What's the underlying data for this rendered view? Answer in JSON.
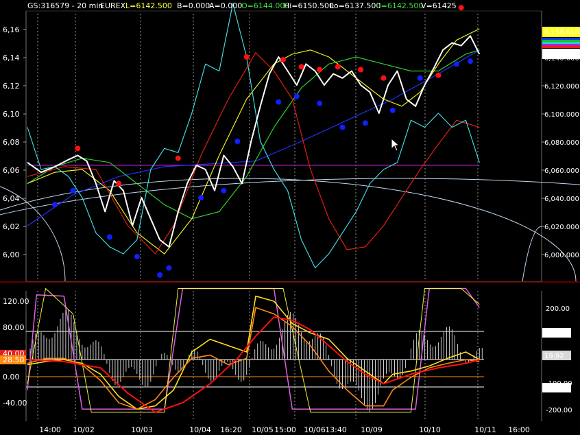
{
  "header": {
    "symbol": "GS:316579 - 20 min",
    "exchange": "EUREX",
    "last": "L=6142.500",
    "bid": "B=0.000",
    "ask": "A=0.000",
    "open": "O=6144.000",
    "high": "Hi=6150.500",
    "low": "Lo=6137.500",
    "close": "C=6142.500",
    "volume": "V=61425"
  },
  "colors": {
    "price": "#ffffff",
    "cyan": "#40d8e0",
    "red_ma": "#e02010",
    "yellow_ma": "#f0f020",
    "green_ma": "#30d030",
    "blue_ma": "#2030ff",
    "magenta_line": "#d020e0",
    "arc": "#c0d8f0",
    "dot_red": "#ff1010",
    "dot_blue": "#1020ff",
    "osc_yellow": "#ffe020",
    "osc_orange": "#ff8c10",
    "osc_red": "#ff1010",
    "osc_magenta": "#e060e0",
    "hist": "#cfcfcf"
  },
  "price_axis": {
    "left_ticks": [
      "6,16",
      "6,14",
      "6,12",
      "6,10",
      "6,08",
      "6,06",
      "6,04",
      "6,02",
      "6,00"
    ],
    "right_ticks": [
      "6,140.000",
      "6,120.000",
      "6,100.000",
      "6,080.000",
      "6,060.000",
      "6,040.000",
      "6,020.000",
      "6,000.000"
    ],
    "badge_top": "6,158.618",
    "badge_last": "6,142.500"
  },
  "osc_axis": {
    "left_ticks": [
      "120.00",
      "80.00",
      "40.00",
      "0.00",
      "-40.00"
    ],
    "right_ticks": [
      "200.00",
      "-200.00"
    ],
    "left_badges": [
      "40.00",
      "28.50"
    ],
    "right_badges": [
      "110.00",
      "19.92",
      "-100.00",
      "-110.00"
    ]
  },
  "time_axis": [
    "14:00",
    "10/02",
    "10/03",
    "10/04",
    "16:20",
    "10/05",
    "15:00",
    "10/06",
    "13:40",
    "10/09",
    "10/10",
    "10/11",
    "16:00"
  ],
  "chart_data": [
    {
      "type": "line",
      "panel": "price",
      "ylim": [
        5990,
        6175
      ],
      "x_index_range": [
        0,
        100
      ],
      "series": [
        {
          "name": "",
          "key": "price",
          "x": [
            0,
            3,
            6,
            9,
            11,
            13,
            15,
            17,
            19,
            21,
            23,
            25,
            27,
            29,
            31,
            33,
            35,
            37,
            39,
            41,
            43,
            45,
            47,
            49,
            51,
            53,
            55,
            57,
            59,
            61,
            63,
            65,
            67,
            69,
            71,
            73,
            75,
            77,
            79,
            81,
            83,
            85,
            87,
            89,
            91,
            93,
            95,
            97,
            99
          ],
          "values": [
            6065,
            6058,
            6062,
            6067,
            6070,
            6066,
            6050,
            6030,
            6052,
            6045,
            6020,
            6040,
            6025,
            6010,
            6005,
            6030,
            6050,
            6063,
            6060,
            6045,
            6070,
            6062,
            6050,
            6080,
            6105,
            6128,
            6140,
            6130,
            6120,
            6135,
            6130,
            6120,
            6128,
            6125,
            6130,
            6120,
            6115,
            6100,
            6120,
            6130,
            6110,
            6105,
            6120,
            6132,
            6145,
            6150,
            6148,
            6155,
            6142
          ]
        },
        {
          "name": "",
          "key": "cyan",
          "x": [
            0,
            3,
            6,
            9,
            12,
            15,
            18,
            21,
            24,
            27,
            30,
            33,
            36,
            39,
            42,
            45,
            48,
            51,
            54,
            57,
            60,
            63,
            66,
            69,
            72,
            75,
            78,
            81,
            84,
            87,
            90,
            93,
            96,
            99
          ],
          "values": [
            6090,
            6060,
            6062,
            6055,
            6040,
            6015,
            6005,
            6000,
            6010,
            6060,
            6075,
            6072,
            6100,
            6135,
            6130,
            6178,
            6140,
            6080,
            6060,
            6045,
            6010,
            5990,
            6000,
            6015,
            6030,
            6050,
            6060,
            6065,
            6095,
            6090,
            6100,
            6090,
            6095,
            6065
          ]
        },
        {
          "name": "",
          "key": "red_ma",
          "x": [
            0,
            8,
            15,
            22,
            28,
            32,
            38,
            44,
            50,
            54,
            58,
            62,
            66,
            70,
            74,
            78,
            82,
            86,
            90,
            94,
            99
          ],
          "values": [
            6055,
            6062,
            6060,
            6020,
            6000,
            6020,
            6070,
            6110,
            6143,
            6130,
            6110,
            6060,
            6025,
            6003,
            6005,
            6020,
            6040,
            6060,
            6078,
            6095,
            6090
          ]
        },
        {
          "name": "",
          "key": "yellow_ma",
          "x": [
            0,
            6,
            12,
            18,
            24,
            30,
            36,
            42,
            48,
            54,
            58,
            62,
            66,
            70,
            74,
            78,
            82,
            86,
            90,
            94,
            99
          ],
          "values": [
            6050,
            6058,
            6060,
            6045,
            6015,
            6000,
            6025,
            6070,
            6110,
            6135,
            6142,
            6145,
            6140,
            6130,
            6120,
            6110,
            6105,
            6115,
            6135,
            6152,
            6160
          ]
        },
        {
          "name": "",
          "key": "green_ma",
          "x": [
            0,
            6,
            12,
            18,
            24,
            30,
            36,
            42,
            48,
            54,
            60,
            66,
            72,
            78,
            84,
            90,
            96,
            99
          ],
          "values": [
            6050,
            6062,
            6068,
            6065,
            6050,
            6035,
            6025,
            6030,
            6055,
            6090,
            6118,
            6135,
            6140,
            6135,
            6130,
            6130,
            6142,
            6145
          ]
        },
        {
          "name": "",
          "key": "blue_ma",
          "x": [
            0,
            10,
            20,
            30,
            40,
            50,
            60,
            70,
            80,
            90,
            99
          ],
          "values": [
            6020,
            6042,
            6055,
            6062,
            6064,
            6066,
            6080,
            6095,
            6110,
            6128,
            6145
          ]
        },
        {
          "name": "",
          "key": "magenta_line",
          "x": [
            0,
            99
          ],
          "values": [
            6063,
            6063
          ]
        }
      ]
    },
    {
      "type": "line",
      "panel": "oscillator",
      "ylim": [
        -60,
        140
      ],
      "series": [
        {
          "name": "",
          "key": "osc_yellow",
          "x": [
            0,
            4,
            8,
            12,
            16,
            20,
            24,
            28,
            32,
            36,
            40,
            44,
            48,
            50,
            54,
            58,
            62,
            66,
            70,
            74,
            78,
            80,
            84,
            88,
            92,
            96,
            99
          ],
          "values": [
            20,
            25,
            28,
            22,
            5,
            -30,
            -50,
            -45,
            -20,
            40,
            60,
            50,
            40,
            128,
            120,
            85,
            70,
            60,
            30,
            10,
            -10,
            5,
            10,
            18,
            30,
            40,
            28
          ]
        },
        {
          "name": "",
          "key": "osc_orange",
          "x": [
            0,
            4,
            8,
            12,
            16,
            20,
            24,
            28,
            32,
            36,
            40,
            44,
            48,
            50,
            54,
            58,
            62,
            66,
            70,
            74,
            78,
            80,
            84,
            88,
            92,
            96,
            99
          ],
          "values": [
            22,
            30,
            30,
            20,
            -5,
            -40,
            -50,
            -35,
            0,
            30,
            35,
            20,
            30,
            110,
            100,
            80,
            50,
            10,
            -20,
            -45,
            -45,
            -20,
            0,
            15,
            22,
            28,
            25
          ]
        },
        {
          "name": "",
          "key": "osc_red",
          "x": [
            0,
            8,
            16,
            22,
            28,
            34,
            40,
            46,
            50,
            54,
            58,
            62,
            66,
            70,
            74,
            78,
            84,
            90,
            96,
            99
          ],
          "values": [
            28,
            25,
            15,
            -25,
            -55,
            -40,
            -10,
            30,
            65,
            95,
            90,
            75,
            50,
            25,
            5,
            -10,
            5,
            15,
            22,
            28
          ]
        }
      ]
    }
  ]
}
